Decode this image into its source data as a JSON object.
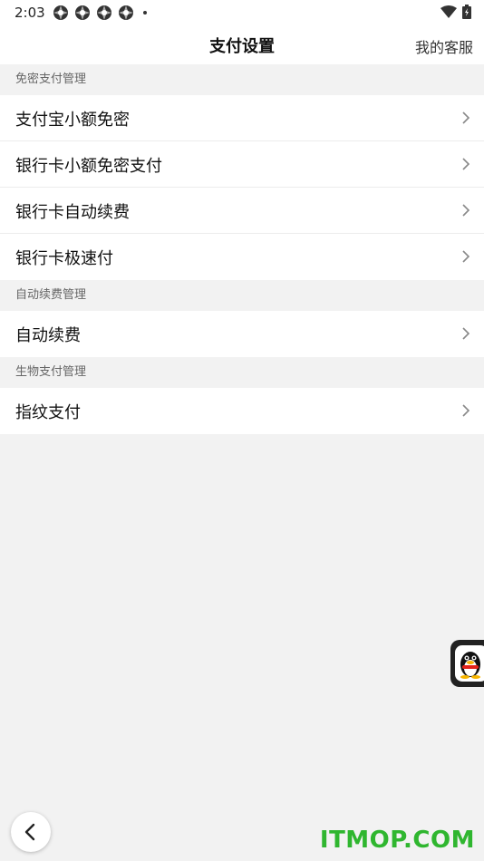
{
  "status_bar": {
    "time": "2:03",
    "icons": [
      "app-notification-icon",
      "app-notification-icon",
      "app-notification-icon",
      "app-notification-icon"
    ],
    "right_icons": [
      "wifi-icon",
      "battery-icon"
    ]
  },
  "header": {
    "title": "支付设置",
    "right_link": "我的客服"
  },
  "sections": [
    {
      "title": "免密支付管理",
      "items": [
        {
          "label": "支付宝小额免密"
        },
        {
          "label": "银行卡小额免密支付"
        },
        {
          "label": "银行卡自动续费"
        },
        {
          "label": "银行卡极速付"
        }
      ]
    },
    {
      "title": "自动续费管理",
      "items": [
        {
          "label": "自动续费"
        }
      ]
    },
    {
      "title": "生物支付管理",
      "items": [
        {
          "label": "指纹支付"
        }
      ]
    }
  ],
  "floating": {
    "qq_icon": "qq-penguin-icon"
  },
  "nav": {
    "back_icon": "chevron-left-icon"
  },
  "watermark": "ITMOP.COM",
  "colors": {
    "background": "#f2f2f2",
    "surface": "#ffffff",
    "watermark": "#2fb62f"
  }
}
